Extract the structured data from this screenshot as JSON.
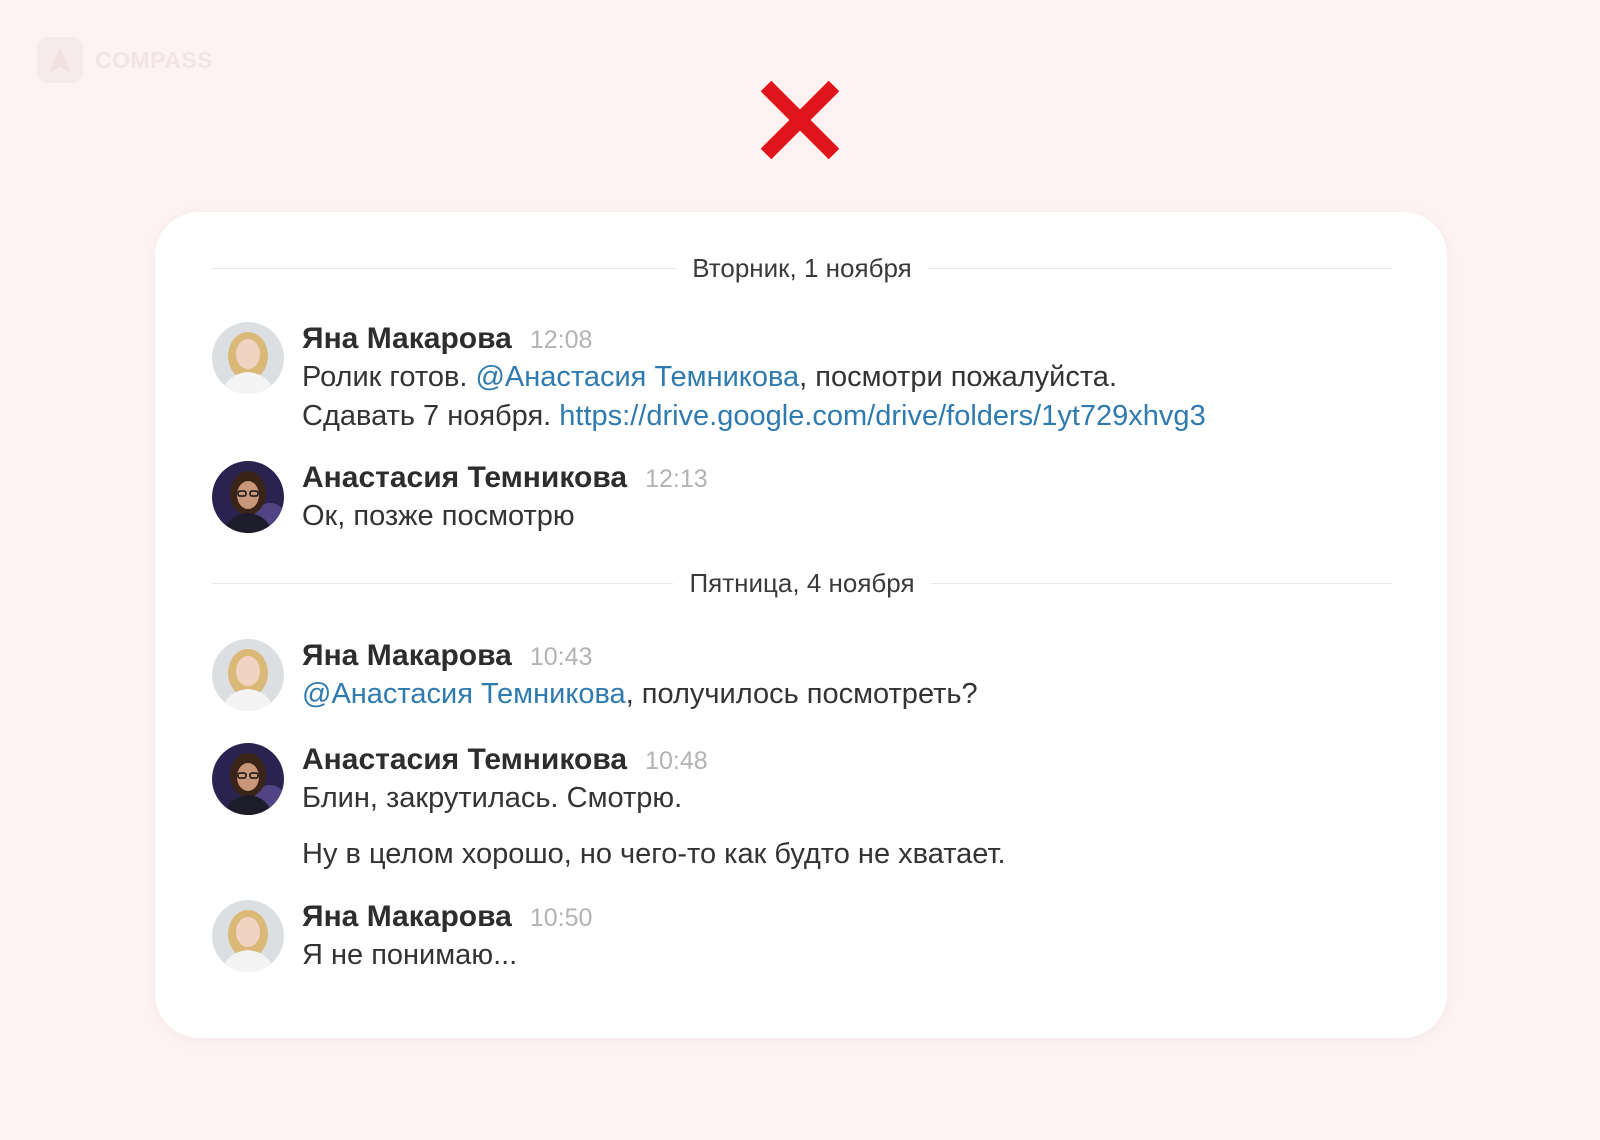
{
  "brand": {
    "name": "COMPASS"
  },
  "status_icon": "cross-icon",
  "chat": {
    "dividers": [
      {
        "label": "Вторник, 1 ноября"
      },
      {
        "label": "Пятница, 4 ноября"
      }
    ],
    "messages": [
      {
        "author": "Яна Макарова",
        "time": "12:08",
        "line1_a": "Ролик готов. ",
        "line1_mention": "@Анастасия Темникова",
        "line1_b": ", посмотри пожалуйста.",
        "line2_a": "Сдавать 7 ноября. ",
        "line2_link": "https://drive.google.com/drive/folders/1yt729xhvg3"
      },
      {
        "author": "Анастасия Темникова",
        "time": "12:13",
        "text": "Ок, позже посмотрю"
      },
      {
        "author": "Яна Макарова",
        "time": "10:43",
        "mention": "@Анастасия Темникова",
        "text": ", получилось посмотреть?"
      },
      {
        "author": "Анастасия Темникова",
        "time": "10:48",
        "text": "Блин, закрутилась. Смотрю.",
        "followup": "Ну в целом хорошо, но чего-то как будто не хватает."
      },
      {
        "author": "Яна Макарова",
        "time": "10:50",
        "text": "Я не понимаю..."
      }
    ]
  },
  "colors": {
    "background": "#fdf3f3",
    "accent_red": "#e0141b",
    "mention_blue": "#2f7bb0"
  }
}
